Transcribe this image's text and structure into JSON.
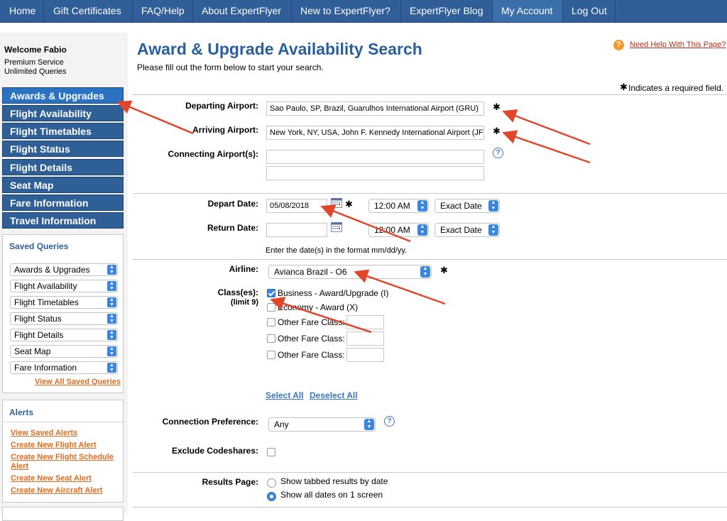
{
  "nav": [
    "Home",
    "Gift Certificates",
    "FAQ/Help",
    "About ExpertFlyer",
    "New to ExpertFlyer?",
    "ExpertFlyer Blog",
    "My Account",
    "Log Out"
  ],
  "sidebar": {
    "welcome": "Welcome Fabio",
    "service": "Premium Service",
    "queries": "Unlimited Queries",
    "menu": [
      "Awards & Upgrades",
      "Flight Availability",
      "Flight Timetables",
      "Flight Status",
      "Flight Details",
      "Seat Map",
      "Fare Information",
      "Travel Information"
    ],
    "saved_title": "Saved Queries",
    "saved": [
      "Awards & Upgrades",
      "Flight Availability",
      "Flight Timetables",
      "Flight Status",
      "Flight Details",
      "Seat Map",
      "Fare Information"
    ],
    "view_all_saved": "View All Saved Queries",
    "alerts_title": "Alerts",
    "alerts": [
      "View Saved Alerts",
      "Create New Flight Alert",
      "Create New Flight Schedule",
      "Alert",
      "Create New Seat Alert",
      "Create New Aircraft Alert"
    ]
  },
  "main": {
    "title": "Award & Upgrade Availability Search",
    "subtitle": "Please fill out the form below to start your search.",
    "need_help": "Need Help With This Page?",
    "required_note": "Indicates a required field.",
    "departing_label": "Departing Airport:",
    "departing_value": "Sao Paulo, SP, Brazil, Guarulhos International Airport (GRU)",
    "arriving_label": "Arriving Airport:",
    "arriving_value": "New York, NY, USA, John F. Kennedy International Airport (JFK)",
    "connecting_label": "Connecting Airport(s):",
    "depart_date_label": "Depart Date:",
    "depart_date_value": "05/08/2018",
    "depart_time": "12:00 AM",
    "depart_exact": "Exact Date",
    "return_date_label": "Return Date:",
    "return_time": "12:00 AM",
    "return_exact": "Exact Date",
    "date_format_note": "Enter the date(s) in the format mm/dd/yy.",
    "airline_label": "Airline:",
    "airline_value": "Avianca Brazil - O6",
    "classes_label": "Class(es):",
    "classes_limit": "(limit 9)",
    "class_business": "Business - Award/Upgrade (I)",
    "class_economy": "Economy - Award (X)",
    "other_fare": "Other Fare Class:",
    "select_all": "Select All",
    "deselect_all": "Deselect All",
    "connection_label": "Connection Preference:",
    "connection_value": "Any",
    "codeshare_label": "Exclude Codeshares:",
    "results_label": "Results Page:",
    "results_tabbed": "Show tabbed results by date",
    "results_all": "Show all dates on 1 screen"
  }
}
